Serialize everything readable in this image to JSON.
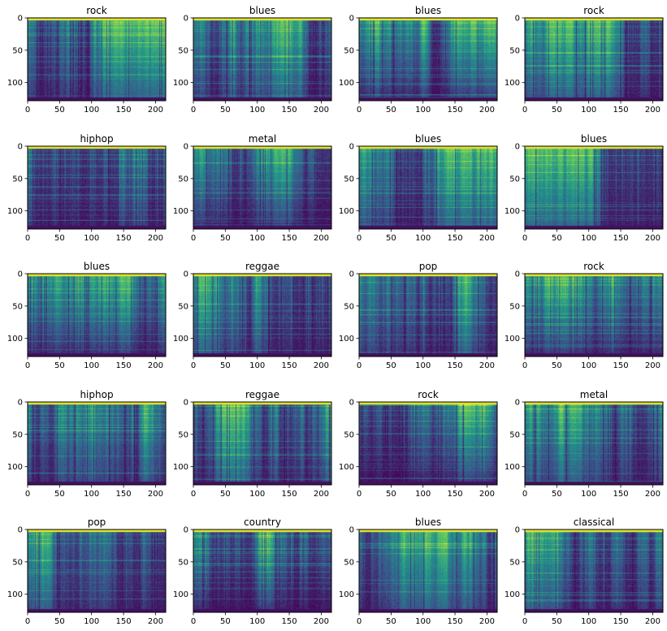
{
  "chart_data": {
    "type": "heatmap",
    "description": "4x5 grid of mel-spectrogram images, one per sampled audio clip, titled with the music genre",
    "colormap": "viridis",
    "colormap_stops": [
      "#440154",
      "#3b528b",
      "#21918c",
      "#5ec962",
      "#fde725"
    ],
    "xlim": [
      0,
      216
    ],
    "ylim": [
      128,
      0
    ],
    "y_inverted": true,
    "xticks": [
      0,
      50,
      100,
      150,
      200
    ],
    "yticks": [
      0,
      50,
      100
    ],
    "grid": false,
    "layout": {
      "rows": 5,
      "cols": 4
    },
    "panels": [
      {
        "title": "rock"
      },
      {
        "title": "blues"
      },
      {
        "title": "blues"
      },
      {
        "title": "rock"
      },
      {
        "title": "hiphop"
      },
      {
        "title": "metal"
      },
      {
        "title": "blues"
      },
      {
        "title": "blues"
      },
      {
        "title": "blues"
      },
      {
        "title": "reggae"
      },
      {
        "title": "pop"
      },
      {
        "title": "rock"
      },
      {
        "title": "hiphop"
      },
      {
        "title": "reggae"
      },
      {
        "title": "rock"
      },
      {
        "title": "metal"
      },
      {
        "title": "pop"
      },
      {
        "title": "country"
      },
      {
        "title": "blues"
      },
      {
        "title": "classical"
      }
    ]
  }
}
